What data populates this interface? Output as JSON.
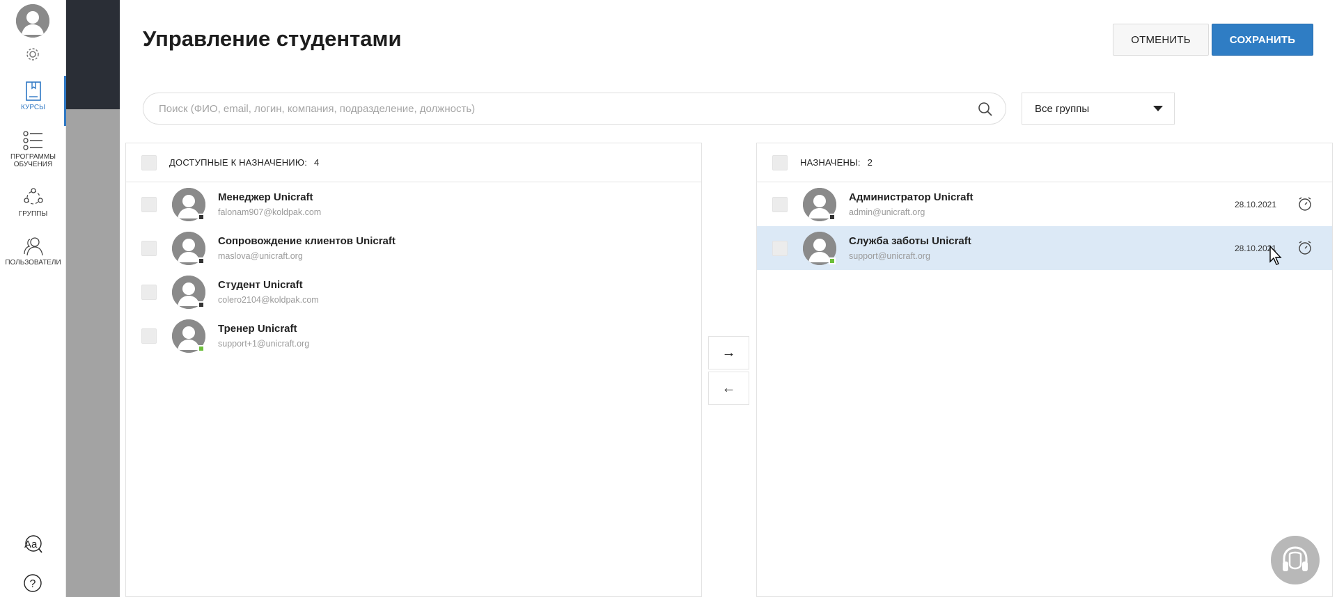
{
  "sidebar": {
    "items": [
      {
        "label": "КУРСЫ",
        "icon": "book-icon",
        "active": true
      },
      {
        "label_line1": "ПРОГРАММЫ",
        "label_line2": "ОБУЧЕНИЯ",
        "icon": "list-icon"
      },
      {
        "label": "ГРУППЫ",
        "icon": "groups-icon"
      },
      {
        "label": "ПОЛЬЗОВАТЕЛИ",
        "icon": "users-icon"
      }
    ],
    "bottom_icons": [
      "font-size-icon",
      "help-icon"
    ]
  },
  "header": {
    "title": "Управление студентами",
    "cancel_label": "ОТМЕНИТЬ",
    "save_label": "СОХРАНИТЬ"
  },
  "search": {
    "placeholder": "Поиск (ФИО, email, логин, компания, подразделение, должность)"
  },
  "group_filter": {
    "selected": "Все группы"
  },
  "available": {
    "label": "ДОСТУПНЫЕ К НАЗНАЧЕНИЮ:",
    "count": "4",
    "users": [
      {
        "name": "Менеджер Unicraft",
        "email": "falonam907@koldpak.com",
        "status": "offline"
      },
      {
        "name": "Сопровождение клиентов Unicraft",
        "email": "maslova@unicraft.org",
        "status": "offline"
      },
      {
        "name": "Студент Unicraft",
        "email": "colero2104@koldpak.com",
        "status": "offline"
      },
      {
        "name": "Тренер Unicraft",
        "email": "support+1@unicraft.org",
        "status": "online"
      }
    ]
  },
  "assigned": {
    "label": "НАЗНАЧЕНЫ:",
    "count": "2",
    "users": [
      {
        "name": "Администратор Unicraft",
        "email": "admin@unicraft.org",
        "date": "28.10.2021",
        "status": "offline"
      },
      {
        "name": "Служба заботы Unicraft",
        "email": "support@unicraft.org",
        "date": "28.10.2021",
        "status": "online",
        "selected": true
      }
    ]
  },
  "transfer": {
    "right_label": "→",
    "left_label": "←"
  },
  "colors": {
    "accent": "#2f7dc4",
    "selected_row": "#dce9f6",
    "online": "#6cbf3a"
  }
}
